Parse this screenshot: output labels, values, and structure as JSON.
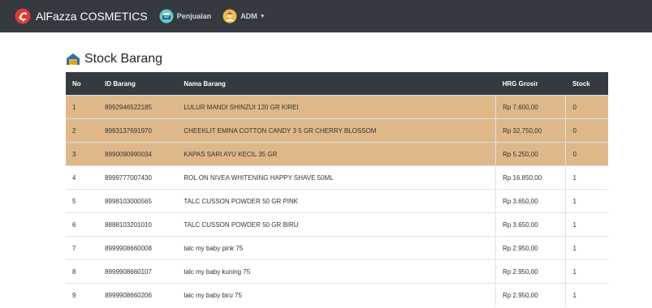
{
  "navbar": {
    "brand": "AlFazza COSMETICS",
    "penjualan": "Penjualan",
    "user": "ADM"
  },
  "page": {
    "title": "Stock Barang"
  },
  "table": {
    "headers": [
      "No",
      "ID Barang",
      "Nama Barang",
      "HRG Grosir",
      "Stock"
    ],
    "rows": [
      {
        "no": "1",
        "id": "8992946522185",
        "name": "LULUR MANDI SHINZUI 120 GR KIREI",
        "hrg": "Rp 7.600,00",
        "stock": "0"
      },
      {
        "no": "2",
        "id": "8993137691970",
        "name": "CHEEKLIT EMINA COTTON CANDY 3 5 GR CHERRY BLOSSOM",
        "hrg": "Rp 32.750,00",
        "stock": "0"
      },
      {
        "no": "3",
        "id": "8990090990034",
        "name": "KAPAS SARI AYU KECIL 35 GR",
        "hrg": "Rp 5.250,00",
        "stock": "0"
      },
      {
        "no": "4",
        "id": "8999777007430",
        "name": "ROL ON NIVEA WHITENING HAPPY SHAVE 50ML",
        "hrg": "Rp 16.850,00",
        "stock": "1"
      },
      {
        "no": "5",
        "id": "8998103000565",
        "name": "TALC CUSSON POWDER 50 GR PINK",
        "hrg": "Rp 3.650,00",
        "stock": "1"
      },
      {
        "no": "6",
        "id": "8888103201010",
        "name": "TALC CUSSON POWDER 50 GR BIRU",
        "hrg": "Rp 3.650,00",
        "stock": "1"
      },
      {
        "no": "7",
        "id": "8999908660008",
        "name": "talc my baby pink 75",
        "hrg": "Rp 2.950,00",
        "stock": "1"
      },
      {
        "no": "8",
        "id": "8999908660107",
        "name": "talc my baby kuning 75",
        "hrg": "Rp 2.950,00",
        "stock": "1"
      },
      {
        "no": "9",
        "id": "8999908660206",
        "name": "talc my baby biru 75",
        "hrg": "Rp 2.950,00",
        "stock": "1"
      }
    ]
  },
  "colors": {
    "navbar_bg": "#343a40",
    "low_stock_row": "#dfb889"
  },
  "icons": {
    "brand": "salon-chair-icon",
    "penjualan": "cash-register-icon",
    "user": "user-avatar-icon",
    "title": "warehouse-icon"
  }
}
